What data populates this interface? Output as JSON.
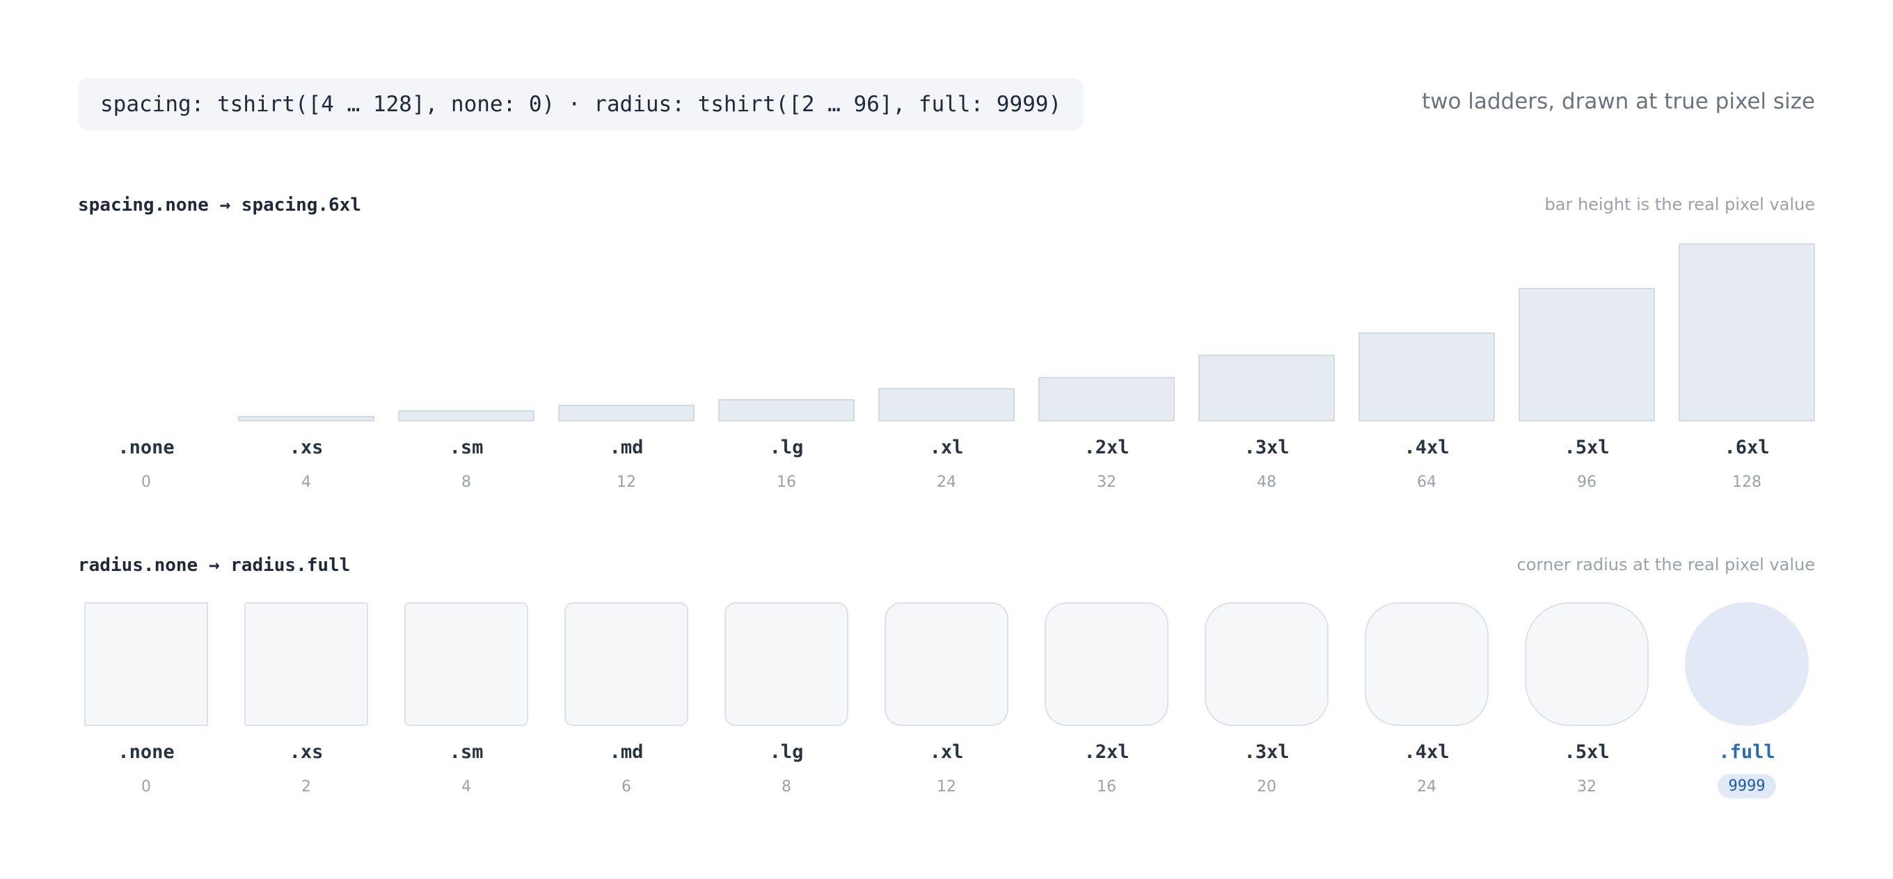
{
  "header": {
    "code": "spacing: tshirt([4 … 128], none: 0) · radius: tshirt([2 … 96], full: 9999)",
    "tagline": "two ladders, drawn at true pixel size"
  },
  "spacing": {
    "title": "spacing.none → spacing.6xl",
    "note": "bar height is the real pixel value",
    "items": [
      {
        "token": ".none",
        "value": 0
      },
      {
        "token": ".xs",
        "value": 4
      },
      {
        "token": ".sm",
        "value": 8
      },
      {
        "token": ".md",
        "value": 12
      },
      {
        "token": ".lg",
        "value": 16
      },
      {
        "token": ".xl",
        "value": 24
      },
      {
        "token": ".2xl",
        "value": 32
      },
      {
        "token": ".3xl",
        "value": 48
      },
      {
        "token": ".4xl",
        "value": 64
      },
      {
        "token": ".5xl",
        "value": 96
      },
      {
        "token": ".6xl",
        "value": 128
      }
    ]
  },
  "radius": {
    "title": "radius.none → radius.full",
    "note": "corner radius at the real pixel value",
    "items": [
      {
        "token": ".none",
        "value": 0
      },
      {
        "token": ".xs",
        "value": 2
      },
      {
        "token": ".sm",
        "value": 4
      },
      {
        "token": ".md",
        "value": 6
      },
      {
        "token": ".lg",
        "value": 8
      },
      {
        "token": ".xl",
        "value": 12
      },
      {
        "token": ".2xl",
        "value": 16
      },
      {
        "token": ".3xl",
        "value": 20
      },
      {
        "token": ".4xl",
        "value": 24
      },
      {
        "token": ".5xl",
        "value": 32
      },
      {
        "token": ".full",
        "value": 9999
      }
    ]
  },
  "colors": {
    "bar_fill": "#e6ebf2",
    "box_fill": "#f6f7f9",
    "accent": "#2b6cb0",
    "accent_fill": "#e1e9f7"
  }
}
